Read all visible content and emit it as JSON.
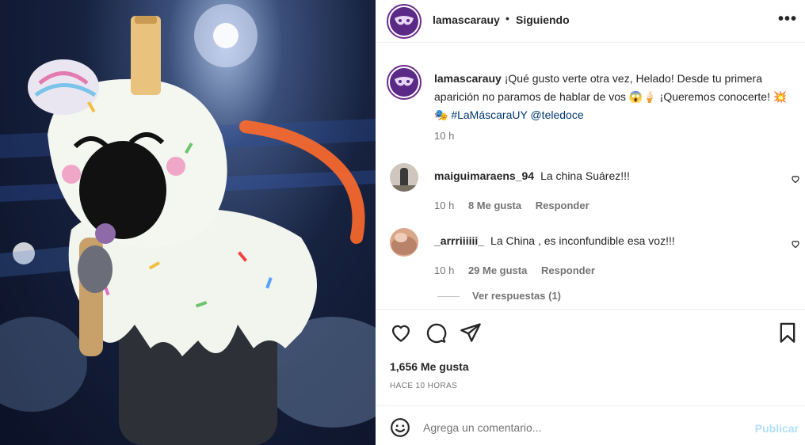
{
  "header": {
    "username": "lamascarauy",
    "separator": "•",
    "follow_status": "Siguiendo",
    "more_icon": "more-horizontal-icon"
  },
  "caption": {
    "username": "lamascarauy",
    "text": "¡Qué gusto verte otra vez, Helado! Desde tu primera aparición no paramos de hablar de vos 😱🍦 ¡Queremos conocerte! 💥🎭",
    "hashtag": "#LaMáscaraUY",
    "mention": "@teledoce",
    "time": "10 h"
  },
  "comments": [
    {
      "username": "maiguimaraens_94",
      "text": "La china Suárez!!!",
      "time": "10 h",
      "likes": "8 Me gusta",
      "reply": "Responder"
    },
    {
      "username": "_arrriiiiii_",
      "text": "La China , es inconfundible esa voz!!!",
      "time": "10 h",
      "likes": "29 Me gusta",
      "reply": "Responder"
    }
  ],
  "view_replies": "Ver respuestas (1)",
  "actions": {
    "like_icon": "heart-icon",
    "comment_icon": "comment-icon",
    "share_icon": "send-icon",
    "save_icon": "bookmark-icon"
  },
  "likes_count": "1,656 Me gusta",
  "posted_ago": "HACE 10 HORAS",
  "comment_box": {
    "placeholder": "Agrega un comentario...",
    "publish": "Publicar"
  },
  "colors": {
    "accent_link": "#00376b",
    "publish_disabled": "#b2dffc",
    "avatar_brand": "#5b2a86"
  }
}
